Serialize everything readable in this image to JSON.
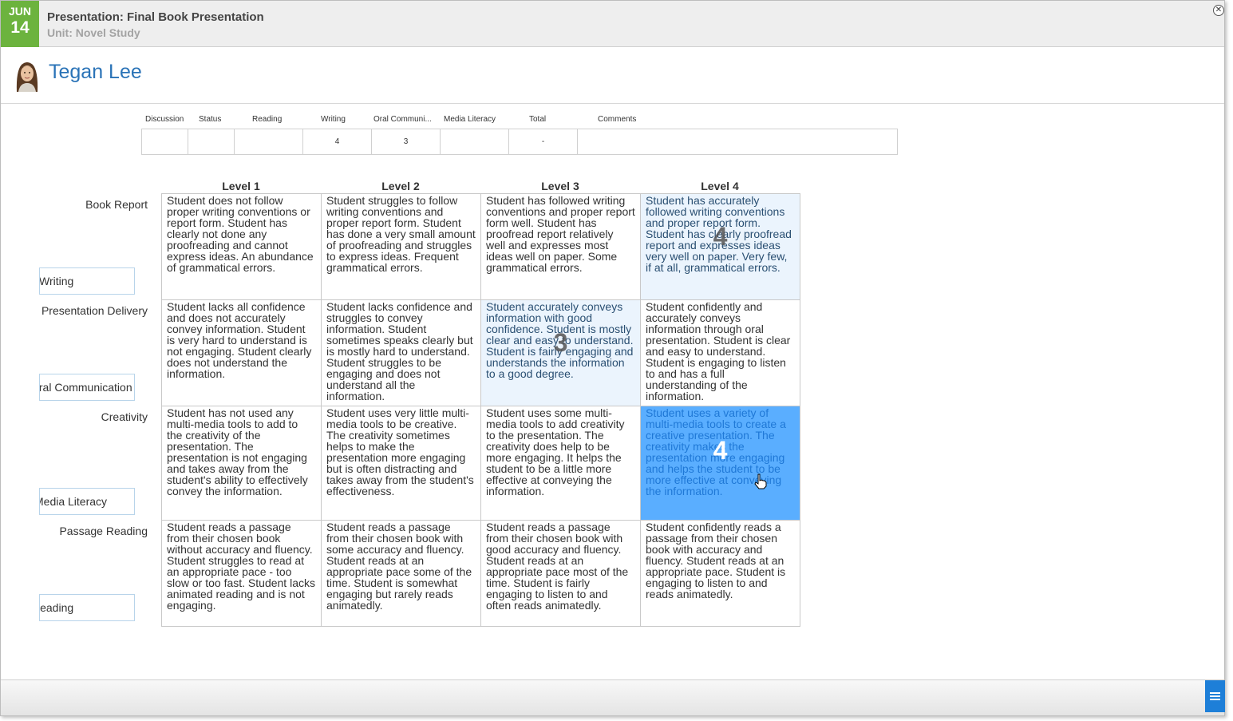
{
  "header": {
    "date_month": "JUN",
    "date_day": "14",
    "title": "Presentation: Final Book Presentation",
    "unit": "Unit: Novel Study",
    "close_icon": "close-circle-icon",
    "accent_color": "#6cb33e"
  },
  "student": {
    "name": "Tegan Lee",
    "name_color": "#2a73b7"
  },
  "grades": {
    "columns": [
      "Discussion",
      "Status",
      "Reading",
      "Writing",
      "Oral Communi...",
      "Media Literacy",
      "Total",
      "Comments"
    ],
    "values": [
      "",
      "",
      "",
      "4",
      "3",
      "",
      "-",
      ""
    ]
  },
  "rubric": {
    "levels": [
      "Level 1",
      "Level 2",
      "Level 3",
      "Level 4"
    ],
    "rows": [
      {
        "label": "Book Report",
        "category": "Writing",
        "selected_level": 4,
        "score": "4",
        "cells": [
          "Student does not follow proper writing conventions or report form. Student has clearly not done any proofreading and cannot express ideas. An abundance of grammatical errors.",
          "Student struggles to follow writing conventions and proper report form. Student has done a very small amount of proofreading and struggles to express ideas. Frequent grammatical errors.",
          "Student has followed writing conventions and proper report form well. Student has proofread report relatively well and expresses most ideas well on paper. Some grammatical errors.",
          "Student has accurately followed writing conventions and proper report form. Student has clearly proofread report and expresses ideas very well on paper. Very few, if at all, grammatical errors."
        ]
      },
      {
        "label": "Presentation Delivery",
        "category": "Oral Communication",
        "selected_level": 3,
        "score": "3",
        "cells": [
          "Student lacks all confidence and does not accurately convey information. Student is very hard to understand is not engaging. Student clearly does not understand the information.",
          "Student lacks confidence and struggles to convey information. Student sometimes speaks clearly but is mostly hard to understand. Student struggles to be engaging and does not understand all the information.",
          "Student accurately conveys information with good confidence. Student is mostly clear and easy to understand. Student is fairly engaging and understands the information to a good degree.",
          "Student confidently and accurately conveys information through oral presentation. Student is clear and easy to understand. Student is engaging to listen to and has a full understanding of the information."
        ]
      },
      {
        "label": "Creativity",
        "category": "Media Literacy",
        "selected_level": 4,
        "score": "4",
        "cells": [
          "Student has not used any multi-media tools to add to the creativity of the presentation. The presentation is not engaging and takes away from the student's ability to effectively convey the information.",
          "Student uses very little multi-media tools to be creative. The creativity sometimes helps to make the presentation more engaging but is often distracting and takes away from the student's effectiveness.",
          "Student uses some multi-media tools to add creativity to the presentation. The creativity does help to be more engaging. It helps the student to be a little more effective at conveying the information.",
          "Student uses a variety of multi-media tools to create a creative presentation. The creativity makes the presentation more engaging and helps the student to be more effective at conveying the information."
        ]
      },
      {
        "label": "Passage Reading",
        "category": "Reading",
        "selected_level": null,
        "score": "",
        "cells": [
          "Student reads a passage from their chosen book without accuracy and fluency. Student struggles to read at an appropriate pace - too slow or too fast. Student lacks animated reading and is not engaging.",
          "Student reads a passage from their chosen book with some accuracy and fluency. Student reads at an appropriate pace some of the time. Student is somewhat engaging but rarely reads animatedly.",
          "Student reads a passage from their chosen book with good accuracy and fluency. Student reads at an appropriate pace most of the time. Student is fairly engaging to listen to and often reads animatedly.",
          "Student confidently reads a passage from their chosen book with accuracy and fluency. Student reads at an appropriate pace. Student is engaging to listen to and reads animatedly."
        ]
      }
    ],
    "highlight_color": "#ebf4fd",
    "selected_color": "#5aaeff"
  },
  "footer": {
    "menu_icon": "hamburger-menu-icon",
    "menu_color": "#1e7fd8"
  }
}
